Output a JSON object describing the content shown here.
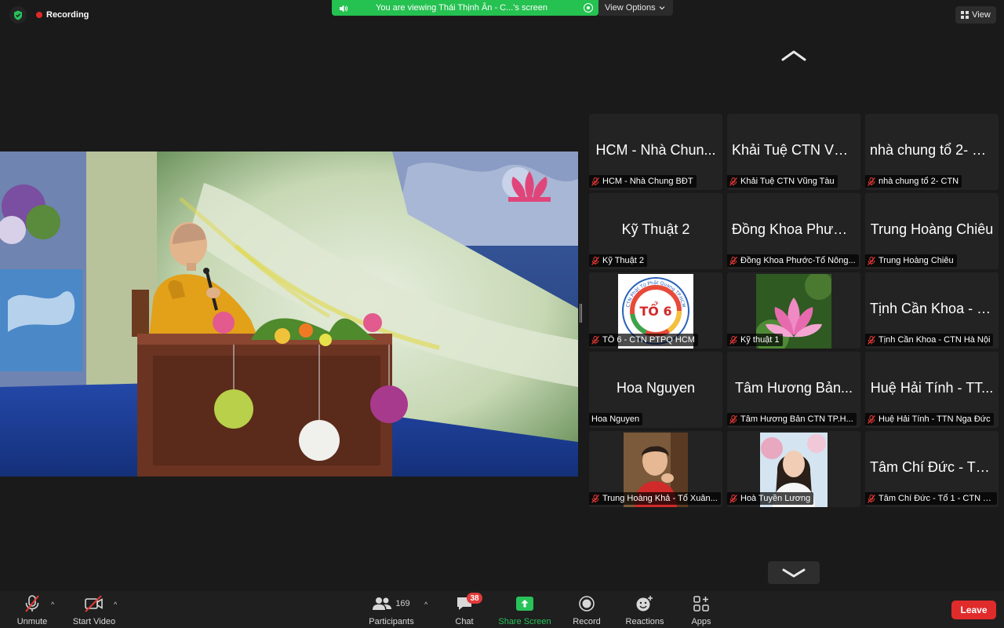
{
  "recording": {
    "label": "Recording"
  },
  "share_banner": {
    "text": "You are viewing Thái Thịnh Ân - C...'s screen"
  },
  "view_options": {
    "label": "View Options"
  },
  "view_button": {
    "label": "View"
  },
  "gallery": {
    "tiles": [
      {
        "big": "HCM - Nhà Chun...",
        "tag": "HCM - Nhà Chung BĐT",
        "muted": true
      },
      {
        "big": "Khải Tuệ CTN Vũn...",
        "tag": "Khải Tuệ CTN Vũng Tàu",
        "muted": true
      },
      {
        "big": "nhà chung tổ 2- C...",
        "tag": "nhà chung tổ 2- CTN",
        "muted": true
      },
      {
        "big": "Kỹ Thuật 2",
        "tag": "Kỹ Thuật 2",
        "muted": true
      },
      {
        "big": "Đồng Khoa Phước...",
        "tag": "Đồng Khoa Phước-Tổ Nông...",
        "muted": true
      },
      {
        "big": "Trung Hoàng Chiêu",
        "tag": "Trung Hoàng Chiêu",
        "muted": true
      },
      {
        "big": "",
        "tag": "TỔ 6 - CTN PTPQ HCM",
        "muted": true,
        "photo": "logo",
        "logo_text": "TỔ 6",
        "logo_ring_text": "CTN Phật Tử Phật Quang TP.HCM"
      },
      {
        "big": "",
        "tag": "Kỹ thuật 1",
        "muted": true,
        "photo": "lotus"
      },
      {
        "big": "Tịnh Cần Khoa - C...",
        "tag": "Tịnh Cần Khoa - CTN Hà Nội",
        "muted": true
      },
      {
        "big": "Hoa Nguyen",
        "tag": "Hoa Nguyen",
        "muted": false
      },
      {
        "big": "Tâm Hương Bản...",
        "tag": "Tâm Hương Bản  CTN TP.H...",
        "muted": true
      },
      {
        "big": "Huệ Hải Tính - TT...",
        "tag": "Huệ Hải Tính - TTN Nga Đức",
        "muted": true
      },
      {
        "big": "",
        "tag": "Trung Hoàng Khả - Tổ Xuân...",
        "muted": true,
        "photo": "boy"
      },
      {
        "big": "",
        "tag": "Hoà Tuyền Lương",
        "muted": true,
        "photo": "girl"
      },
      {
        "big": "Tâm Chí Đức - Tổ...",
        "tag": "Tâm Chí Đức - Tổ 1 - CTN T...",
        "muted": true
      }
    ]
  },
  "toolbar": {
    "unmute": "Unmute",
    "start_video": "Start Video",
    "participants": "Participants",
    "participants_count": "169",
    "chat": "Chat",
    "chat_badge": "38",
    "share_screen": "Share Screen",
    "record": "Record",
    "reactions": "Reactions",
    "apps": "Apps",
    "leave": "Leave"
  },
  "colors": {
    "share_green": "#25c151",
    "leave_red": "#e02b2b",
    "mute_red": "#e53935",
    "background": "#1a1a1a"
  }
}
